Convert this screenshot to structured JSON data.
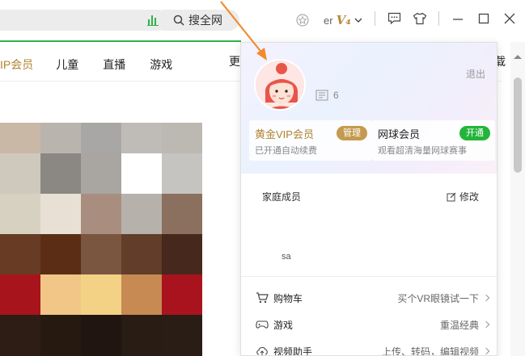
{
  "titlebar": {
    "search_label": "搜全网",
    "user_text": "er",
    "vip_level_text": "V₄",
    "icons": [
      "chart-icon",
      "search-icon",
      "avatar-icon",
      "chevron-down-icon",
      "message-icon",
      "skin-icon",
      "minimize-icon",
      "maximize-icon",
      "close-icon"
    ]
  },
  "nav": {
    "items": [
      "IP会员",
      "儿童",
      "直播",
      "游戏"
    ],
    "right_partial": "更",
    "far_right_partial": "载"
  },
  "panel": {
    "logout": "退出",
    "level_value": "6",
    "cards": {
      "gold": {
        "title": "黄金VIP会员",
        "subtitle": "已开通自动续费",
        "button": "管理"
      },
      "ball": {
        "title": "网球会员",
        "subtitle": "观看超清海量网球赛事",
        "button": "开通"
      }
    },
    "family": {
      "title": "家庭成员",
      "edit": "修改",
      "member_name": "sa"
    },
    "menu": [
      {
        "label": "购物车",
        "hint": "买个VR眼镜试一下",
        "icon": "cart-icon"
      },
      {
        "label": "游戏",
        "hint": "重温经典",
        "icon": "gamepad-icon"
      },
      {
        "label": "视频助手",
        "hint": "上传、转码，编辑视频",
        "icon": "cloud-upload-icon"
      }
    ]
  },
  "colors": {
    "brand_green": "#2fb349",
    "vip_gold": "#b08330",
    "manage_button": "#c49a4e",
    "open_button": "#23b53b",
    "annotation_arrow": "#f28a2e"
  },
  "mosaic_colors": [
    [
      "#c9b8a6",
      "#b9b4ae",
      "#a9a7a5",
      "#bfbcb8",
      "#bcb8b2",
      "#ffffff"
    ],
    [
      "#cfc9bd",
      "#8b8782",
      "#a9a6a1",
      "#ffffff",
      "#c6c4c0",
      "#ffffff"
    ],
    [
      "#d7d1c2",
      "#e8e0d4",
      "#a98e80",
      "#b6b2ab",
      "#8b705f",
      "#ffffff"
    ],
    [
      "#673b24",
      "#5c2d15",
      "#7a5540",
      "#613d2a",
      "#47281c",
      "#ffffff"
    ],
    [
      "#a8141c",
      "#f1c686",
      "#f3d185",
      "#c78a52",
      "#a8131e",
      "#ffffff"
    ],
    [
      "#2e1d14",
      "#251910",
      "#201510",
      "#281c14",
      "#2a1d15",
      "#ffffff"
    ]
  ]
}
